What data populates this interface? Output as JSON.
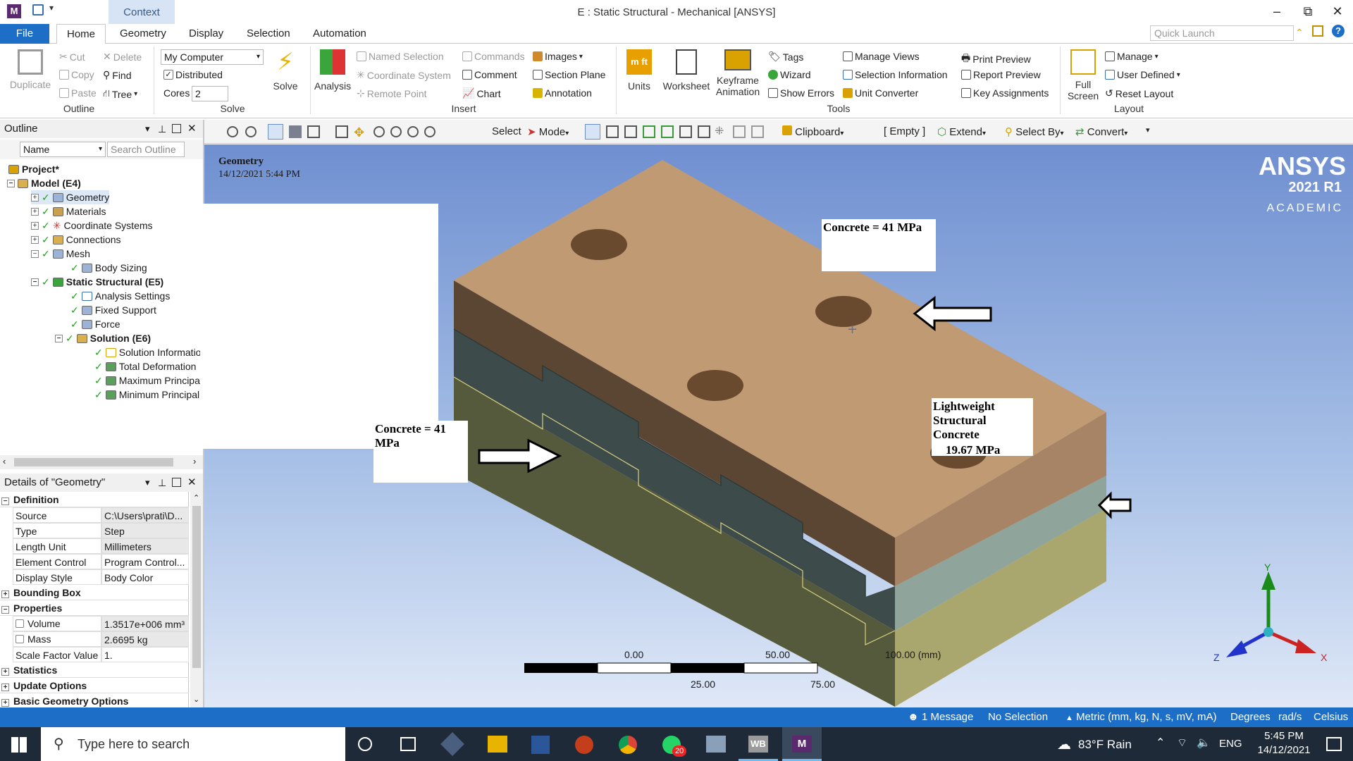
{
  "window": {
    "app_icon": "M",
    "context_tab": "Context",
    "title": "E : Static Structural - Mechanical [ANSYS]",
    "minimize": "–",
    "restore": "⧉",
    "close": "✕"
  },
  "tabs": {
    "file": "File",
    "home": "Home",
    "geometry": "Geometry",
    "display": "Display",
    "selection": "Selection",
    "automation": "Automation"
  },
  "quick_launch": {
    "placeholder": "Quick Launch"
  },
  "ribbon": {
    "outline": {
      "duplicate": "Duplicate",
      "cut": "Cut",
      "copy": "Copy",
      "paste": "Paste",
      "delete": "Delete",
      "find": "Find",
      "tree": "Tree",
      "group": "Outline"
    },
    "solve": {
      "computer": "My Computer",
      "distributed": "Distributed",
      "cores_label": "Cores",
      "cores": "2",
      "solve": "Solve",
      "group": "Solve"
    },
    "insert": {
      "analysis": "Analysis",
      "named_selection": "Named Selection",
      "coordinate_system": "Coordinate System",
      "remote_point": "Remote Point",
      "commands": "Commands",
      "comment": "Comment",
      "chart": "Chart",
      "images": "Images",
      "section_plane": "Section Plane",
      "annotation": "Annotation",
      "group": "Insert"
    },
    "tools": {
      "units": "Units",
      "units_icon": "m ft",
      "worksheet": "Worksheet",
      "keyframe": "Keyframe",
      "animation": "Animation",
      "tags": "Tags",
      "wizard": "Wizard",
      "show_errors": "Show Errors",
      "manage_views": "Manage Views",
      "selection_information": "Selection Information",
      "unit_converter": "Unit Converter",
      "print_preview": "Print Preview",
      "report_preview": "Report Preview",
      "key_assignments": "Key Assignments",
      "group": "Tools"
    },
    "layout": {
      "full": "Full",
      "screen": "Screen",
      "manage": "Manage",
      "user_defined": "User Defined",
      "reset_layout": "Reset Layout",
      "group": "Layout"
    }
  },
  "outline": {
    "title": "Outline",
    "name_col": "Name",
    "search": "Search Outline",
    "items": [
      "Project*",
      "Model (E4)",
      "Geometry",
      "Materials",
      "Coordinate Systems",
      "Connections",
      "Mesh",
      "Body Sizing",
      "Static Structural (E5)",
      "Analysis Settings",
      "Fixed Support",
      "Force",
      "Solution (E6)",
      "Solution Informatior",
      "Total Deformation",
      "Maximum Principal S",
      "Minimum Principal St"
    ]
  },
  "details": {
    "title": "Details of \"Geometry\"",
    "sections": {
      "definition": "Definition",
      "bounding_box": "Bounding Box",
      "properties": "Properties",
      "statistics": "Statistics",
      "update_options": "Update Options",
      "basic_geometry": "Basic Geometry Options"
    },
    "rows": [
      {
        "label": "Source",
        "value": "C:\\Users\\prati\\D..."
      },
      {
        "label": "Type",
        "value": "Step"
      },
      {
        "label": "Length Unit",
        "value": "Millimeters"
      },
      {
        "label": "Element Control",
        "value": "Program Control..."
      },
      {
        "label": "Display Style",
        "value": "Body Color"
      }
    ],
    "props": [
      {
        "label": "Volume",
        "value": "1.3517e+006 mm³"
      },
      {
        "label": "Mass",
        "value": "2.6695 kg"
      },
      {
        "label": "Scale Factor Value",
        "value": "1."
      }
    ]
  },
  "toolbar": {
    "select": "Select",
    "mode": "Mode",
    "clipboard": "Clipboard",
    "empty": "[ Empty ]",
    "extend": "Extend",
    "select_by": "Select By",
    "convert": "Convert"
  },
  "viewport": {
    "title": "Geometry",
    "date": "14/12/2021 5:44 PM",
    "brand": "ANSYS",
    "version": "2021 R1",
    "edition": "ACADEMIC",
    "note_top": "Concrete = 41 MPa",
    "note_left": "Concrete = 41 MPa",
    "note_right_1": "Lightweight",
    "note_right_2": "Structural Concrete",
    "note_right_3": "19.67 MPa",
    "scale": {
      "s0": "0.00",
      "s50": "50.00",
      "s100": "100.00 (mm)",
      "s25": "25.00",
      "s75": "75.00"
    },
    "axes": {
      "x": "X",
      "y": "Y",
      "z": "Z"
    },
    "colors": {
      "top": "#c09a72",
      "front_top": "#5b4633",
      "front_mid": "#3e4b4b",
      "front_bot": "#555a3c",
      "side_top": "#a88466",
      "side_mid": "#8fa49a",
      "side_bot": "#aaa76e"
    }
  },
  "status": {
    "messages": "1 Message",
    "selection": "No Selection",
    "units": "Metric (mm, kg, N, s, mV, mA)",
    "degrees": "Degrees",
    "rads": "rad/s",
    "temp": "Celsius"
  },
  "taskbar": {
    "search": "Type here to search",
    "weather": "83°F  Rain",
    "lang": "ENG",
    "time": "5:45 PM",
    "date": "14/12/2021",
    "whatsapp_badge": "20",
    "wb": "WB",
    "mech": "M"
  }
}
